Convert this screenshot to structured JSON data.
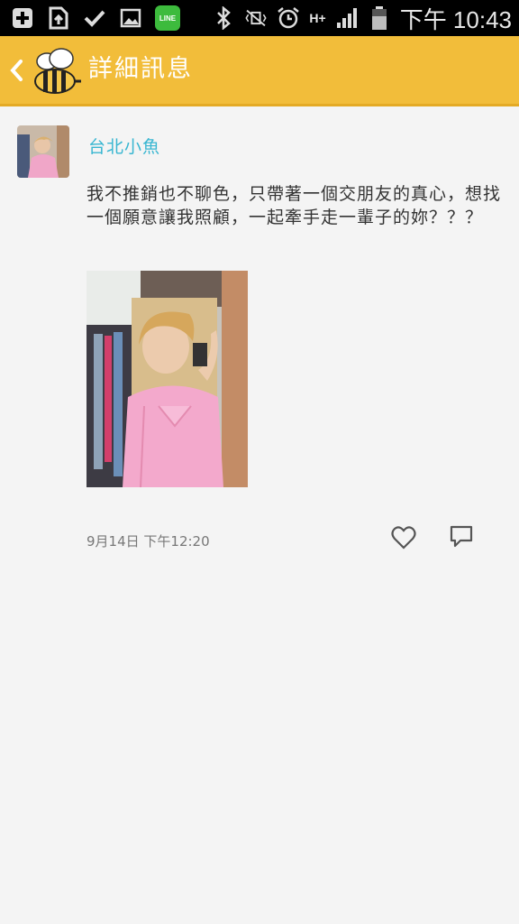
{
  "statusbar": {
    "icons_left": [
      "add-box-icon",
      "file-upload-icon",
      "check-icon",
      "image-icon",
      "line-app-icon"
    ],
    "line_label": "LINE",
    "icons_right": [
      "bluetooth-icon",
      "vibrate-off-icon",
      "alarm-icon",
      "network-h-plus-icon",
      "signal-icon",
      "battery-icon"
    ],
    "network": "H+",
    "time": "下午 10:43"
  },
  "header": {
    "title": "詳細訊息"
  },
  "post": {
    "username": "台北小魚",
    "text": "我不推銷也不聊色，只帶著一個交朋友的真心，想找一個願意讓我照顧，一起牽手走一輩子的妳？？？",
    "timestamp": "9月14日 下午12:20"
  },
  "colors": {
    "header": "#f2bd3a",
    "username": "#38b6d1",
    "background": "#f4f4f4"
  }
}
